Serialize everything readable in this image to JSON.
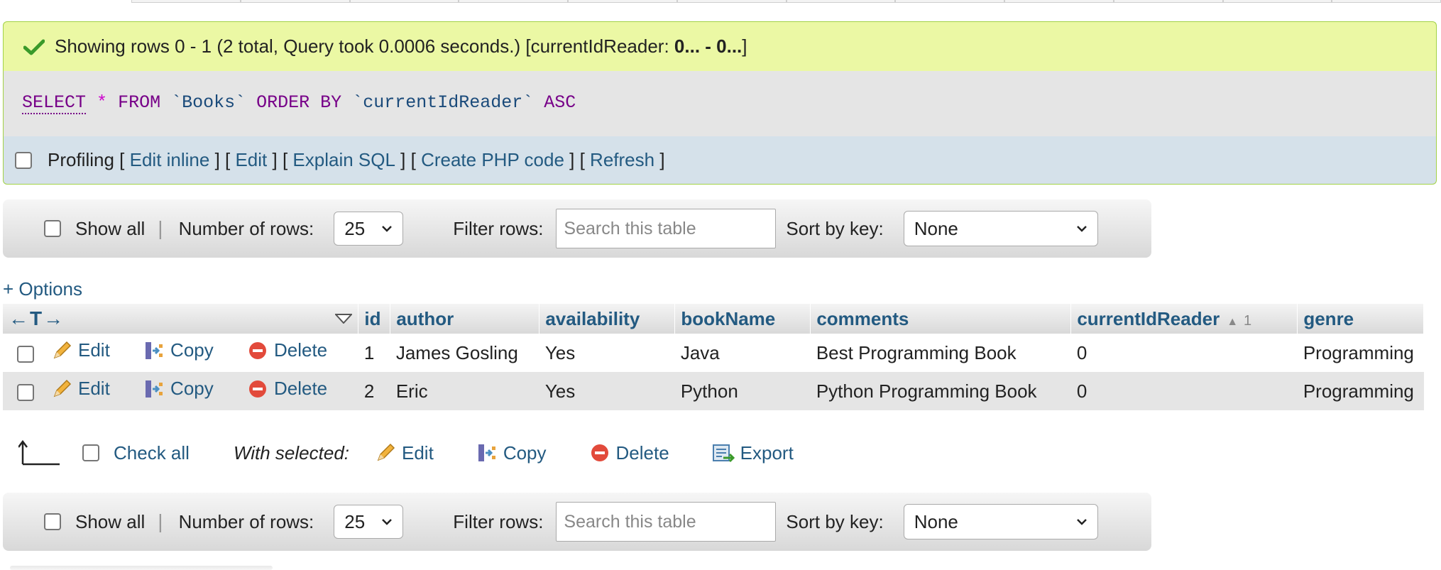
{
  "success": {
    "prefix": "Showing rows 0 - 1 (2 total, Query took 0.0006 seconds.) [currentIdReader: ",
    "range": "0... - 0...",
    "suffix": "]"
  },
  "sql": {
    "select": "SELECT",
    "star": "*",
    "from": "FROM",
    "table": "`Books`",
    "order_by": "ORDER BY",
    "column": "`currentIdReader`",
    "asc": "ASC"
  },
  "profiling": {
    "label": "Profiling",
    "links": [
      "Edit inline",
      "Edit",
      "Explain SQL",
      "Create PHP code",
      "Refresh"
    ]
  },
  "nav": {
    "show_all": "Show all",
    "sep": "|",
    "rows_label": "Number of rows:",
    "rows_value": "25",
    "filter_label": "Filter rows:",
    "filter_placeholder": "Search this table",
    "sort_label": "Sort by key:",
    "sort_value": "None"
  },
  "options_link": "+ Options",
  "table": {
    "arrows": "←T→",
    "headers": [
      "id",
      "author",
      "availability",
      "bookName",
      "comments",
      "currentIdReader",
      "genre"
    ],
    "sort_order": "1",
    "actions": {
      "edit": "Edit",
      "copy": "Copy",
      "delete": "Delete"
    },
    "rows": [
      {
        "id": "1",
        "author": "James Gosling",
        "availability": "Yes",
        "bookName": "Java",
        "comments": "Best Programming Book",
        "currentIdReader": "0",
        "genre": "Programming"
      },
      {
        "id": "2",
        "author": "Eric",
        "availability": "Yes",
        "bookName": "Python",
        "comments": "Python Programming Book",
        "currentIdReader": "0",
        "genre": "Programming"
      }
    ]
  },
  "bulk": {
    "check_all": "Check all",
    "with_selected": "With selected:",
    "edit": "Edit",
    "copy": "Copy",
    "delete": "Delete",
    "export": "Export"
  },
  "colors": {
    "link": "#235a81",
    "success_bg": "#ebf8a4",
    "success_border": "#a2d246",
    "sql_bg": "#e5e5e5",
    "profiling_bg": "#d5e1ea",
    "keyword": "#770088"
  }
}
